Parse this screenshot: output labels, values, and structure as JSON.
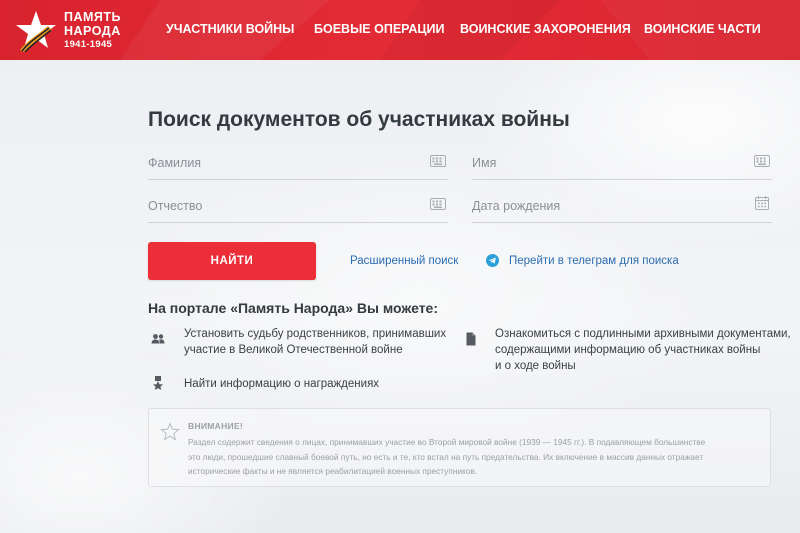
{
  "header": {
    "logo": {
      "line1": "ПАМЯТЬ",
      "line2": "НАРОДА",
      "years": "1941-1945"
    },
    "nav": [
      {
        "label": "УЧАСТНИКИ ВОЙНЫ"
      },
      {
        "label": "БОЕВЫЕ ОПЕРАЦИИ"
      },
      {
        "label": "ВОИНСКИЕ ЗАХОРОНЕНИЯ"
      },
      {
        "label": "ВОИНСКИЕ ЧАСТИ"
      }
    ]
  },
  "search": {
    "title": "Поиск документов об участниках войны",
    "fields": {
      "last_name": "Фамилия",
      "first_name": "Имя",
      "patronymic": "Отчество",
      "birth_date": "Дата рождения"
    },
    "find_button": "НАЙТИ",
    "advanced_link": "Расширенный поиск",
    "telegram_link": "Перейти в телеграм для поиска"
  },
  "features": {
    "heading": "На портале «Память Народа» Вы можете:",
    "items": [
      {
        "icon": "people-icon",
        "line1": "Установить судьбу родственников, принимавших",
        "line2": "участие в Великой Отечественной войне"
      },
      {
        "icon": "document-icon",
        "line1": "Ознакомиться с подлинными архивными документами,",
        "line2": "содержащими информацию об участниках войны",
        "line3": "и о ходе войны"
      },
      {
        "icon": "medal-icon",
        "line1": "Найти информацию о награждениях"
      }
    ]
  },
  "notice": {
    "title": "ВНИМАНИЕ!",
    "line1": "Раздел содержит сведения о лицах, принимавших участие во Второй мировой войне (1939 — 1945 гг.). В подавляющем большинстве",
    "line2": "это люди, прошедшие славный боевой путь, но есть и те, кто встал на путь предательства. Их включение в массив данных отражает",
    "line3": "исторические факты и не является реабилитацией военных преступников."
  },
  "colors": {
    "brand_red": "#e32b35",
    "button_red": "#ec2e38",
    "link_blue": "#2b6cb0",
    "telegram_blue": "#2a9fd9"
  }
}
